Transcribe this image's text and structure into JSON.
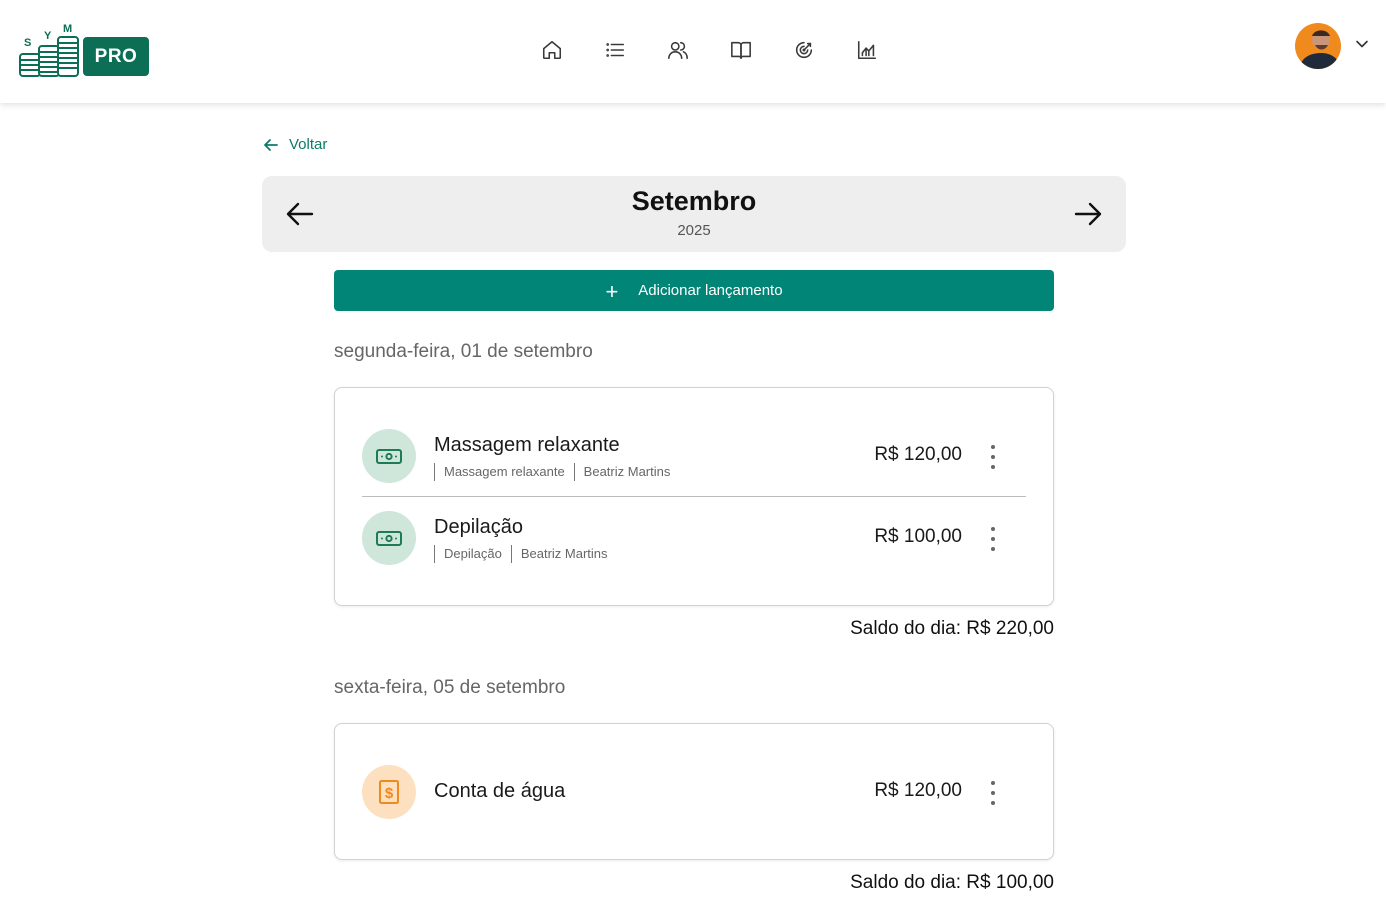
{
  "header": {
    "logo_letters": [
      "S",
      "Y",
      "M"
    ],
    "logo_badge": "PRO",
    "nav": [
      {
        "name": "home-icon"
      },
      {
        "name": "list-icon"
      },
      {
        "name": "users-icon"
      },
      {
        "name": "book-icon"
      },
      {
        "name": "target-icon"
      },
      {
        "name": "chart-icon"
      }
    ],
    "avatar": "avatar",
    "avatar_caret": "chevron-down-icon"
  },
  "back": {
    "label": "Voltar"
  },
  "month_nav": {
    "month": "Setembro",
    "year": "2025"
  },
  "add_button": {
    "label": "Adicionar lançamento",
    "icon": "+"
  },
  "days": [
    {
      "heading": "segunda-feira, 01 de setembro",
      "entries": [
        {
          "title": "Massagem relaxante",
          "tags": [
            "Massagem relaxante",
            "Beatriz Martins"
          ],
          "amount": "R$ 120,00",
          "icon": "cash-icon",
          "icon_color": "#1f7a57"
        },
        {
          "title": "Depilação",
          "tags": [
            "Depilação",
            "Beatriz Martins"
          ],
          "amount": "R$ 100,00",
          "icon": "cash-icon",
          "icon_color": "#1f7a57"
        }
      ],
      "saldo": "Saldo do dia: R$ 220,00"
    },
    {
      "heading": "sexta-feira, 05 de setembro",
      "entries": [
        {
          "title": "Conta de água",
          "tags": [],
          "amount": "R$ 120,00",
          "icon": "dollar-bill-icon",
          "icon_color": "#f08a1c"
        }
      ],
      "saldo": "Saldo do dia: R$ 100,00"
    }
  ],
  "colors": {
    "accent": "#008577",
    "brand": "#0b6e55",
    "income_icon_bg": "#cfe6da",
    "expense_icon_bg": "#fde0c0"
  }
}
